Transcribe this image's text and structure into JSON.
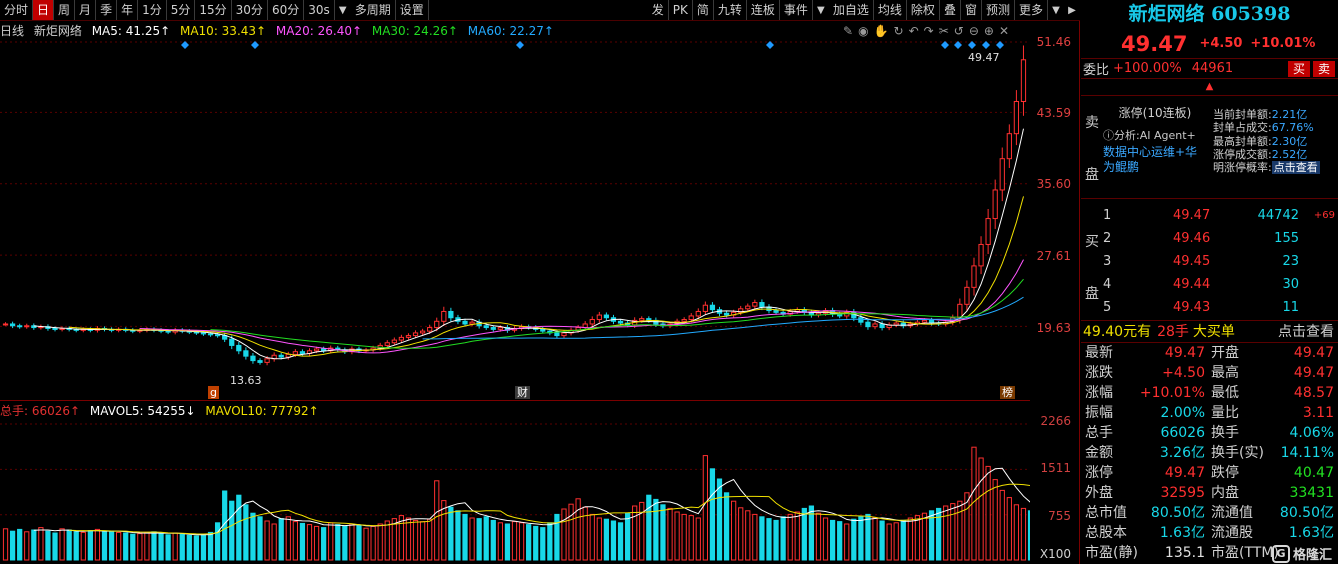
{
  "toolbar": {
    "periods": [
      "分时",
      "日",
      "周",
      "月",
      "季",
      "年",
      "1分",
      "5分",
      "15分",
      "30分",
      "60分",
      "30s",
      "多周期",
      "设置"
    ],
    "active_period": "日",
    "right_items": [
      "发",
      "PK",
      "简",
      "九转",
      "连板",
      "事件",
      "加自选",
      "均线",
      "除权",
      "叠",
      "窗",
      "预测",
      "更多"
    ]
  },
  "ma_line": {
    "period": "日线",
    "name": "新炬网络",
    "ma5": "MA5: 41.25↑",
    "ma10": "MA10: 33.43↑",
    "ma20": "MA20: 26.40↑",
    "ma30": "MA30: 24.26↑",
    "ma60": "MA60: 22.27↑"
  },
  "price_axis": [
    "51.46",
    "43.59",
    "35.60",
    "27.61",
    "19.63"
  ],
  "price_labels": {
    "high": "49.47",
    "low": "13.63",
    "tag_g": "g",
    "tag_cai": "财",
    "tag_bang": "榜"
  },
  "volume_line": {
    "total": "总手: 66026↑",
    "mavol5": "MAVOL5: 54255↓",
    "mavol10": "MAVOL10: 77792↑"
  },
  "volume_axis": [
    "2266",
    "1511",
    "755",
    "X100"
  ],
  "chart_data": {
    "type": "candlestick",
    "period": "日线",
    "ylim": [
      13.63,
      51.46
    ],
    "last_close": 49.47,
    "period_low": 13.63,
    "closes": [
      19.9,
      19.7,
      19.6,
      19.7,
      19.5,
      19.6,
      19.4,
      19.3,
      19.4,
      19.3,
      19.2,
      19.3,
      19.2,
      19.4,
      19.3,
      19.2,
      19.3,
      19.2,
      19.1,
      19.2,
      19.3,
      19.2,
      19.1,
      19.0,
      19.2,
      19.1,
      19.0,
      18.9,
      18.8,
      18.7,
      18.6,
      18.2,
      17.5,
      16.9,
      16.3,
      15.8,
      15.6,
      16.0,
      16.4,
      16.2,
      16.5,
      16.8,
      16.6,
      16.9,
      17.1,
      16.9,
      17.2,
      17.0,
      16.8,
      17.1,
      16.9,
      17.0,
      17.2,
      17.5,
      17.8,
      18.1,
      18.4,
      18.6,
      18.9,
      19.1,
      19.5,
      20.2,
      21.3,
      20.6,
      20.2,
      19.9,
      20.1,
      19.7,
      19.5,
      19.3,
      19.5,
      19.2,
      19.4,
      19.6,
      19.5,
      19.3,
      19.1,
      18.9,
      18.6,
      18.9,
      19.2,
      19.5,
      19.9,
      20.4,
      20.9,
      20.6,
      20.2,
      20.0,
      19.8,
      20.3,
      20.5,
      20.3,
      19.9,
      19.7,
      19.9,
      20.2,
      20.4,
      20.8,
      21.3,
      22.0,
      21.5,
      21.1,
      20.9,
      21.2,
      21.6,
      21.9,
      22.3,
      21.8,
      21.4,
      21.2,
      21.0,
      21.3,
      21.5,
      21.2,
      20.9,
      21.1,
      21.4,
      21.0,
      20.8,
      21.2,
      20.6,
      20.1,
      19.6,
      19.9,
      19.5,
      19.8,
      20.0,
      19.7,
      19.9,
      20.1,
      20.3,
      20.0,
      19.9,
      20.1,
      20.6,
      22.1,
      24.0,
      26.4,
      28.8,
      31.7,
      34.9,
      38.4,
      41.2,
      44.8,
      49.47
    ],
    "volume": [
      520,
      480,
      510,
      470,
      500,
      540,
      480,
      450,
      520,
      500,
      470,
      460,
      490,
      510,
      480,
      470,
      460,
      450,
      430,
      440,
      460,
      470,
      440,
      420,
      450,
      430,
      410,
      400,
      420,
      460,
      620,
      1150,
      980,
      1080,
      920,
      780,
      720,
      650,
      600,
      690,
      720,
      640,
      610,
      590,
      560,
      540,
      620,
      590,
      560,
      600,
      580,
      530,
      560,
      600,
      650,
      690,
      740,
      700,
      660,
      640,
      680,
      1320,
      990,
      880,
      820,
      760,
      700,
      690,
      720,
      660,
      620,
      600,
      640,
      620,
      590,
      560,
      540,
      620,
      760,
      850,
      930,
      1020,
      880,
      760,
      700,
      680,
      650,
      620,
      780,
      900,
      960,
      1080,
      1010,
      920,
      860,
      800,
      760,
      740,
      700,
      1740,
      1520,
      1350,
      1120,
      980,
      870,
      820,
      760,
      720,
      690,
      660,
      720,
      760,
      800,
      860,
      900,
      780,
      700,
      660,
      640,
      600,
      680,
      720,
      760,
      700,
      650,
      600,
      620,
      660,
      700,
      740,
      780,
      820,
      860,
      900,
      940,
      980,
      1120,
      1880,
      1700,
      1560,
      1340,
      1160,
      1040,
      920,
      860,
      820,
      660
    ]
  },
  "side": {
    "title": "新炬网络 605398",
    "price": "49.47",
    "change": "+4.50",
    "change_pct": "+10.01%",
    "weibi_label": "委比",
    "weibi_pct": "+100.00%",
    "weibi_num": "44961",
    "buy_btn": "买",
    "sell_btn": "卖",
    "sell_label": "卖盘",
    "buy_label": "买盘",
    "zt_title": "涨停(10连板)",
    "zt_ai": "分析:AI Agent+",
    "zt_tag": "数据中心运维+华为鲲鹏",
    "zt_stats": [
      {
        "k": "当前封单额:",
        "v": "2.21亿"
      },
      {
        "k": "封单占成交:",
        "v": "67.76%"
      },
      {
        "k": "最高封单额:",
        "v": "2.30亿"
      },
      {
        "k": "涨停成交额:",
        "v": "2.52亿"
      },
      {
        "k": "明涨停概率:",
        "v": "点击查看"
      }
    ],
    "buys": [
      {
        "lvl": "1",
        "price": "49.47",
        "qty": "44742",
        "delta": "+69"
      },
      {
        "lvl": "2",
        "price": "49.46",
        "qty": "155",
        "delta": ""
      },
      {
        "lvl": "3",
        "price": "49.45",
        "qty": "23",
        "delta": ""
      },
      {
        "lvl": "4",
        "price": "49.44",
        "qty": "30",
        "delta": ""
      },
      {
        "lvl": "5",
        "price": "49.43",
        "qty": "11",
        "delta": ""
      }
    ],
    "dadan": {
      "a": "49.40元有",
      "b": "28手",
      "c": "大买单",
      "d": "点击查看"
    },
    "quotes": [
      {
        "k1": "最新",
        "v1": "49.47",
        "c1": "red",
        "k2": "开盘",
        "v2": "49.47",
        "c2": "red"
      },
      {
        "k1": "涨跌",
        "v1": "+4.50",
        "c1": "red",
        "k2": "最高",
        "v2": "49.47",
        "c2": "red"
      },
      {
        "k1": "涨幅",
        "v1": "+10.01%",
        "c1": "red",
        "k2": "最低",
        "v2": "48.57",
        "c2": "red"
      },
      {
        "k1": "振幅",
        "v1": "2.00%",
        "c1": "cyan",
        "k2": "量比",
        "v2": "3.11",
        "c2": "red"
      },
      {
        "k1": "总手",
        "v1": "66026",
        "c1": "cyan",
        "k2": "换手",
        "v2": "4.06%",
        "c2": "cyan"
      },
      {
        "k1": "金额",
        "v1": "3.26亿",
        "c1": "cyan",
        "k2": "换手(实)",
        "v2": "14.11%",
        "c2": "cyan"
      },
      {
        "k1": "涨停",
        "v1": "49.47",
        "c1": "red",
        "k2": "跌停",
        "v2": "40.47",
        "c2": "green"
      },
      {
        "k1": "外盘",
        "v1": "32595",
        "c1": "red",
        "k2": "内盘",
        "v2": "33431",
        "c2": "green"
      },
      {
        "k1": "总市值",
        "v1": "80.50亿",
        "c1": "cyan",
        "k2": "流通值",
        "v2": "80.50亿",
        "c2": "cyan"
      },
      {
        "k1": "总股本",
        "v1": "1.63亿",
        "c1": "cyan",
        "k2": "流通股",
        "v2": "1.63亿",
        "c2": "cyan"
      },
      {
        "k1": "市盈(静)",
        "v1": "135.1",
        "c1": "white",
        "k2": "市盈(TTM)",
        "v2": "",
        "c2": "white"
      }
    ],
    "watermark": "格隆汇"
  },
  "colors": {
    "up": "#ff3030",
    "down": "#18d8e8",
    "grid": "#5a0000"
  }
}
